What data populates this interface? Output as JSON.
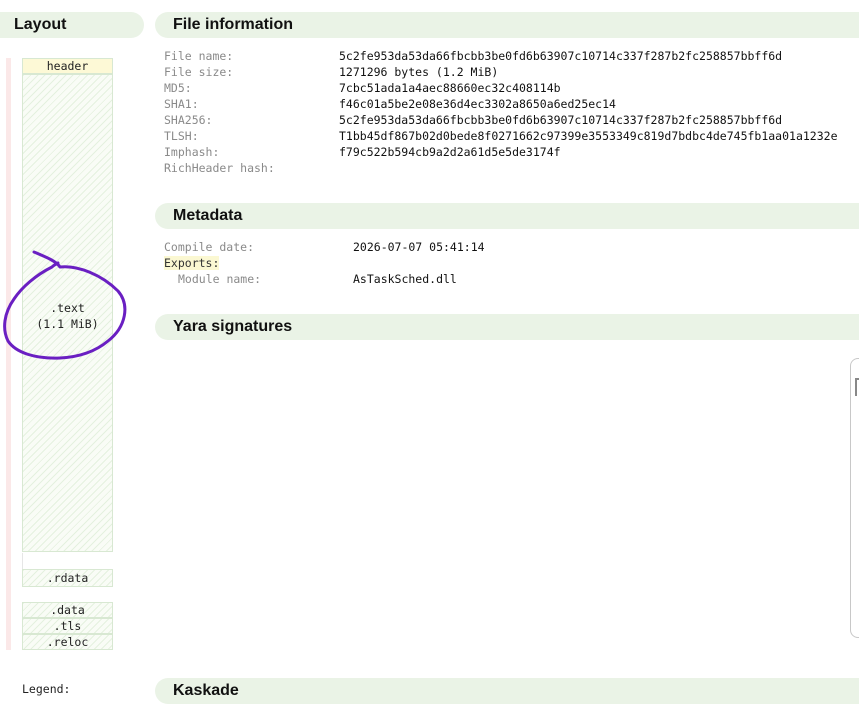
{
  "layout": {
    "title": "Layout",
    "sections": {
      "header": "header",
      "text": ".text",
      "text_size": "(1.1 MiB)",
      "rdata": ".rdata",
      "data": ".data",
      "tls": ".tls",
      "reloc": ".reloc"
    },
    "legend_label": "Legend:"
  },
  "file_information": {
    "title": "File information",
    "rows": [
      {
        "key": "File name:",
        "value": "5c2fe953da53da66fbcbb3be0fd6b63907c10714c337f287b2fc258857bbff6d"
      },
      {
        "key": "File size:",
        "value": "1271296 bytes (1.2 MiB)"
      },
      {
        "key": "MD5:",
        "value": "7cbc51ada1a4aec88660ec32c408114b"
      },
      {
        "key": "SHA1:",
        "value": "f46c01a5be2e08e36d4ec3302a8650a6ed25ec14"
      },
      {
        "key": "SHA256:",
        "value": "5c2fe953da53da66fbcbb3be0fd6b63907c10714c337f287b2fc258857bbff6d"
      },
      {
        "key": "TLSH:",
        "value": "T1bb45df867b02d0bede8f0271662c97399e3553349c819d7bdbc4de745fb1aa01a1232e"
      },
      {
        "key": "Imphash:",
        "value": "f79c522b594cb9a2d2a61d5e5de3174f"
      },
      {
        "key": "RichHeader hash:",
        "value": ""
      }
    ]
  },
  "metadata": {
    "title": "Metadata",
    "compile_date_key": "Compile date:",
    "compile_date_value": "2026-07-07 05:41:14",
    "exports_label": "Exports:",
    "module_name_key": "Module name:",
    "module_name_value": "AsTaskSched.dll"
  },
  "yara": {
    "title": "Yara signatures"
  },
  "kaskade": {
    "title": "Kaskade"
  },
  "colors": {
    "section_header_bg": "#eaf3e6",
    "header_box_bg": "#fdf9d6",
    "annotation_stroke": "#6a1fc2"
  }
}
